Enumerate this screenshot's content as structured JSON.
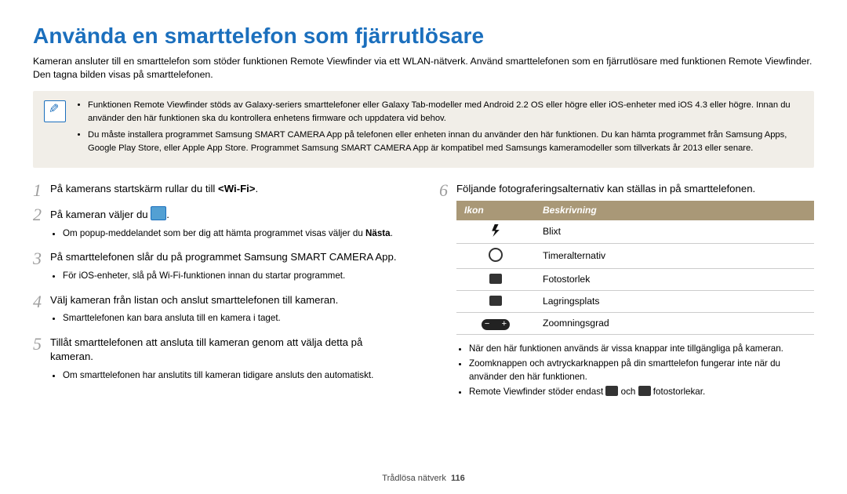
{
  "title": "Använda en smarttelefon som fjärrutlösare",
  "intro": "Kameran ansluter till en smarttelefon som stöder funktionen Remote Viewfinder via ett WLAN-nätverk. Använd smarttelefonen som en fjärrutlösare med funktionen Remote Viewfinder. Den tagna bilden visas på smarttelefonen.",
  "note": {
    "b1": "Funktionen Remote Viewfinder stöds av Galaxy-seriers smarttelefoner eller Galaxy Tab-modeller med Android 2.2 OS eller högre eller iOS-enheter med iOS 4.3 eller högre. Innan du använder den här funktionen ska du kontrollera enhetens firmware och uppdatera vid behov.",
    "b2": "Du måste installera programmet Samsung SMART CAMERA App på telefonen eller enheten innan du använder den här funktionen. Du kan hämta programmet från Samsung Apps, Google Play Store, eller Apple App Store. Programmet Samsung SMART CAMERA App är kompatibel med Samsungs kameramodeller som tillverkats år 2013 eller senare."
  },
  "steps": {
    "s1_a": "På kamerans startskärm rullar du till ",
    "s1_b": "<Wi-Fi>",
    "s1_c": ".",
    "s2_a": "På kameran väljer du ",
    "s2_b": ".",
    "s2_sub_a": "Om popup-meddelandet som ber dig att hämta programmet visas väljer du ",
    "s2_sub_b": "Nästa",
    "s2_sub_c": ".",
    "s3": "På smarttelefonen slår du på programmet Samsung SMART CAMERA App.",
    "s3_sub": "För iOS-enheter, slå på Wi-Fi-funktionen innan du startar programmet.",
    "s4": "Välj kameran från listan och anslut smarttelefonen till kameran.",
    "s4_sub": "Smarttelefonen kan bara ansluta till en kamera i taget.",
    "s5": "Tillåt smarttelefonen att ansluta till kameran genom att välja detta på kameran.",
    "s5_sub": "Om smarttelefonen har anslutits till kameran tidigare ansluts den automatiskt.",
    "s6": "Följande fotograferingsalternativ kan ställas in på smarttelefonen."
  },
  "table": {
    "h1": "Ikon",
    "h2": "Beskrivning",
    "r1": "Blixt",
    "r2": "Timeralternativ",
    "r3": "Fotostorlek",
    "r4": "Lagringsplats",
    "r5": "Zoomningsgrad"
  },
  "post": {
    "p1": "När den här funktionen används är vissa knappar inte tillgängliga på kameran.",
    "p2": "Zoomknappen och avtryckarknappen på din smarttelefon fungerar inte när du använder den här funktionen.",
    "p3_a": "Remote Viewfinder stöder endast ",
    "p3_b": " och ",
    "p3_c": " fotostorlekar."
  },
  "footer": {
    "section": "Trådlösa nätverk",
    "page": "116"
  }
}
